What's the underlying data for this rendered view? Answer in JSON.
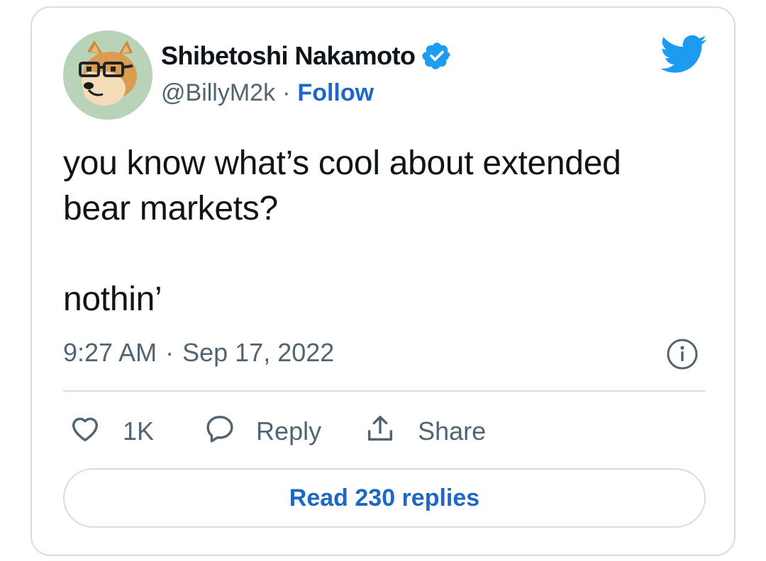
{
  "author": {
    "name": "Shibetoshi Nakamoto",
    "handle": "@BillyM2k",
    "separator": "·",
    "follow_label": "Follow",
    "verified": true,
    "avatar_icon": "doge-with-glasses-avatar"
  },
  "brand": {
    "logo_icon": "twitter-bird-icon",
    "accent_color": "#1d9bf0",
    "link_color": "#1d68c5"
  },
  "tweet": {
    "text": "you know what’s cool about extended\nbear markets?\n\nnothin’",
    "time": "9:27 AM",
    "separator": "·",
    "date": "Sep 17, 2022"
  },
  "actions": {
    "like_count": "1K",
    "reply_label": "Reply",
    "share_label": "Share"
  },
  "read_replies_label": "Read 230 replies"
}
